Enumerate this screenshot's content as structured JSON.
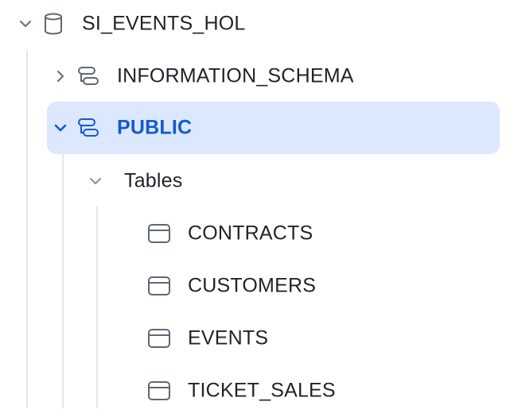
{
  "colors": {
    "selected_background": "#dbe8fd",
    "selected_text": "#1658d0",
    "text": "#1f2329",
    "icon": "#5f6775",
    "guide_line": "#e3e6eb"
  },
  "tree": {
    "database": {
      "label": "SI_EVENTS_HOL",
      "expanded": true,
      "icon": "database-icon"
    },
    "schemas": [
      {
        "label": "INFORMATION_SCHEMA",
        "expanded": false,
        "icon": "schema-icon"
      },
      {
        "label": "PUBLIC",
        "expanded": true,
        "selected": true,
        "icon": "schema-icon"
      }
    ],
    "tables_folder": {
      "label": "Tables",
      "expanded": true
    },
    "tables": [
      {
        "label": "CONTRACTS",
        "icon": "table-icon"
      },
      {
        "label": "CUSTOMERS",
        "icon": "table-icon"
      },
      {
        "label": "EVENTS",
        "icon": "table-icon"
      },
      {
        "label": "TICKET_SALES",
        "icon": "table-icon"
      }
    ]
  }
}
